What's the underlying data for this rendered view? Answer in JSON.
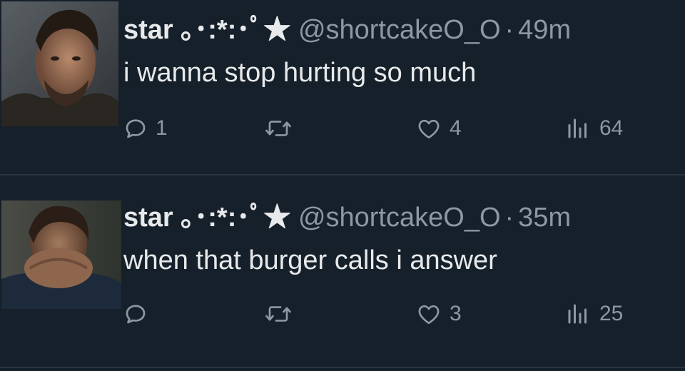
{
  "tweets": [
    {
      "name": "star ｡･:*:･ﾟ★",
      "handle": "@shortcakeO_O",
      "separator": "·",
      "time": "49m",
      "text": "i wanna stop hurting so much",
      "replies": "1",
      "retweets": "",
      "likes": "4",
      "views": "64"
    },
    {
      "name": "star ｡･:*:･ﾟ★",
      "handle": "@shortcakeO_O",
      "separator": "·",
      "time": "35m",
      "text": "when that burger calls i answer",
      "replies": "",
      "retweets": "",
      "likes": "3",
      "views": "25"
    }
  ],
  "colors": {
    "background": "#16202b",
    "text_primary": "#e7e9ea",
    "text_secondary": "#8b98a5",
    "divider": "#2a3440"
  },
  "icons": [
    "reply-icon",
    "retweet-icon",
    "like-icon",
    "views-icon"
  ]
}
